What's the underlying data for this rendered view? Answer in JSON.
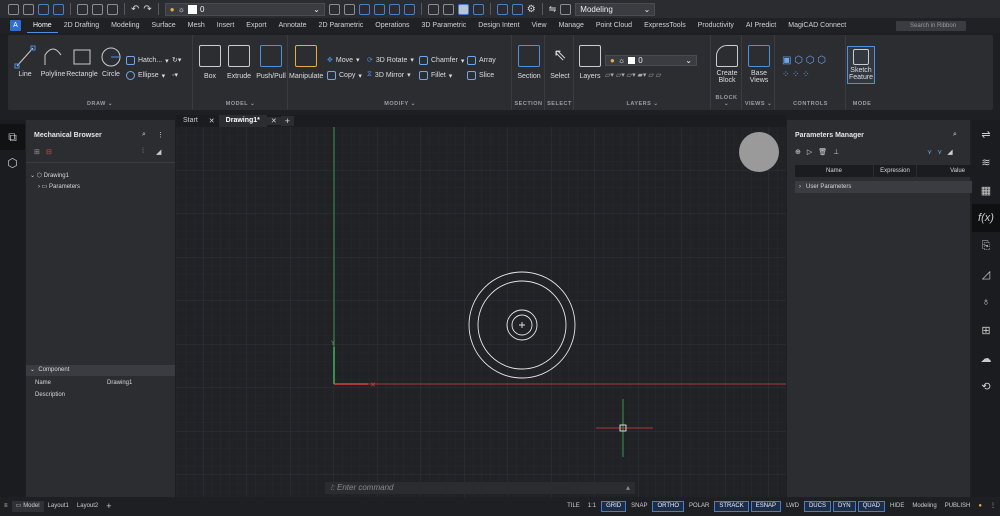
{
  "qat": {
    "layer_value": "0",
    "workspace": "Modeling"
  },
  "tabs": [
    "Home",
    "2D Drafting",
    "Modeling",
    "Surface",
    "Mesh",
    "Insert",
    "Export",
    "Annotate",
    "2D Parametric",
    "Operations",
    "3D Parametric",
    "Design Intent",
    "View",
    "Manage",
    "Point Cloud",
    "ExpressTools",
    "Productivity",
    "AI Predict",
    "MagiCAD Connect"
  ],
  "active_tab": "Home",
  "search_placeholder": "Search in Ribbon",
  "ribbon": {
    "draw": {
      "label": "DRAW",
      "line": "Line",
      "polyline": "Polyline",
      "rectangle": "Rectangle",
      "circle": "Circle",
      "hatch": "Hatch...",
      "ellipse": "Ellipse"
    },
    "model": {
      "label": "MODEL",
      "box": "Box",
      "extrude": "Extrude",
      "pushpull": "Push/Pull"
    },
    "modify": {
      "label": "MODIFY",
      "manipulate": "Manipulate",
      "move": "Move",
      "copy": "Copy",
      "rotate3d": "3D Rotate",
      "mirror3d": "3D Mirror",
      "chamfer": "Chamfer",
      "fillet": "Fillet",
      "array": "Array",
      "slice": "Slice"
    },
    "section": {
      "label": "SECTION",
      "btn": "Section"
    },
    "select": {
      "label": "SELECT",
      "btn": "Select"
    },
    "layers": {
      "label": "LAYERS",
      "btn": "Layers",
      "layer": "0"
    },
    "block": {
      "label": "BLOCK",
      "btn1": "Create",
      "btn2": "Block"
    },
    "views": {
      "label": "VIEWS",
      "btn1": "Base",
      "btn2": "Views"
    },
    "controls": {
      "label": "CONTROLS"
    },
    "mode": {
      "label": "MODE",
      "btn1": "Sketch",
      "btn2": "Feature"
    }
  },
  "left_panel": {
    "title": "Mechanical Browser",
    "tree": [
      {
        "label": "Drawing1"
      },
      {
        "label": "Parameters"
      }
    ],
    "component": {
      "title": "Component",
      "rows": [
        {
          "k": "Name",
          "v": "Drawing1"
        },
        {
          "k": "Description",
          "v": ""
        }
      ]
    }
  },
  "doc_tabs": [
    "Start",
    "Drawing1*"
  ],
  "command_placeholder": "Enter command",
  "right_panel": {
    "title": "Parameters Manager",
    "columns": [
      "Name",
      "Expression",
      "Value"
    ],
    "rows": [
      "User Parameters"
    ]
  },
  "status": {
    "layouts": [
      "Model",
      "Layout1",
      "Layout2"
    ],
    "items": [
      "TILE",
      "1:1",
      "GRID",
      "SNAP",
      "ORTHO",
      "POLAR",
      "STRACK",
      "ESNAP",
      "LWD",
      "DUCS",
      "DYN",
      "QUAD",
      "HIDE",
      "Modeling",
      "PUBLISH"
    ],
    "on": [
      "GRID",
      "ORTHO",
      "STRACK",
      "ESNAP",
      "DUCS",
      "DYN",
      "QUAD"
    ]
  },
  "colors": {
    "accent": "#4d8fe0",
    "x_axis": "#d9413f",
    "y_axis": "#3fb55a",
    "canvas": "#212226"
  }
}
